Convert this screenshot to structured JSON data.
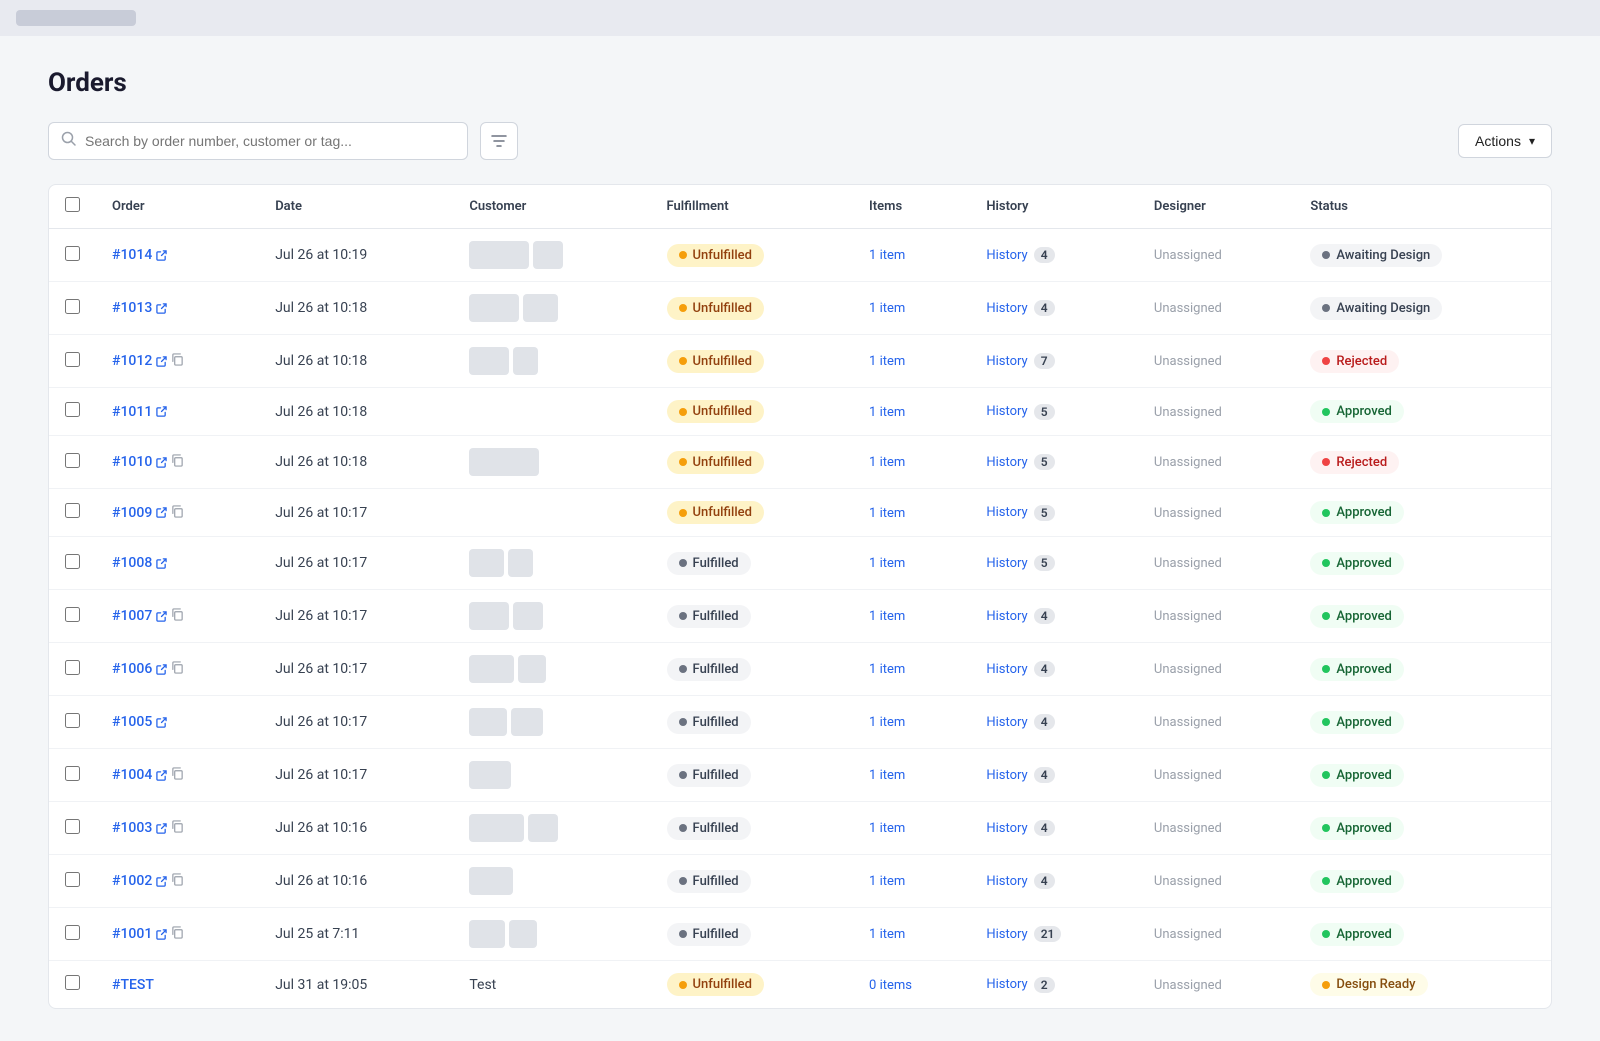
{
  "topbar": {
    "placeholder": "topbar-logo"
  },
  "page": {
    "title": "Orders"
  },
  "toolbar": {
    "search_placeholder": "Search by order number, customer or tag...",
    "actions_label": "Actions"
  },
  "table": {
    "columns": [
      "",
      "Order",
      "Date",
      "Customer",
      "Fulfillment",
      "Items",
      "History",
      "Designer",
      "Status"
    ],
    "rows": [
      {
        "id": "row-1014",
        "order": "#1014",
        "date": "Jul 26 at 10:19",
        "customer_blocks": [
          60,
          30
        ],
        "fulfillment": "Unfulfilled",
        "fulfillment_type": "unfulfilled",
        "items": "1 item",
        "history": "History",
        "history_count": "4",
        "designer": "Unassigned",
        "status": "Awaiting Design",
        "status_type": "awaiting",
        "has_external_icon": true,
        "has_copy_icon": false
      },
      {
        "id": "row-1013",
        "order": "#1013",
        "date": "Jul 26 at 10:18",
        "customer_blocks": [
          50,
          35
        ],
        "fulfillment": "Unfulfilled",
        "fulfillment_type": "unfulfilled",
        "items": "1 item",
        "history": "History",
        "history_count": "4",
        "designer": "Unassigned",
        "status": "Awaiting Design",
        "status_type": "awaiting",
        "has_external_icon": true,
        "has_copy_icon": false
      },
      {
        "id": "row-1012",
        "order": "#1012",
        "date": "Jul 26 at 10:18",
        "customer_blocks": [
          40,
          25
        ],
        "fulfillment": "Unfulfilled",
        "fulfillment_type": "unfulfilled",
        "items": "1 item",
        "history": "History",
        "history_count": "7",
        "designer": "Unassigned",
        "status": "Rejected",
        "status_type": "rejected",
        "has_external_icon": true,
        "has_copy_icon": true
      },
      {
        "id": "row-1011",
        "order": "#1011",
        "date": "Jul 26 at 10:18",
        "customer_blocks": [],
        "fulfillment": "Unfulfilled",
        "fulfillment_type": "unfulfilled",
        "items": "1 item",
        "history": "History",
        "history_count": "5",
        "designer": "Unassigned",
        "status": "Approved",
        "status_type": "approved",
        "has_external_icon": true,
        "has_copy_icon": false
      },
      {
        "id": "row-1010",
        "order": "#1010",
        "date": "Jul 26 at 10:18",
        "customer_blocks": [
          70
        ],
        "fulfillment": "Unfulfilled",
        "fulfillment_type": "unfulfilled",
        "items": "1 item",
        "history": "History",
        "history_count": "5",
        "designer": "Unassigned",
        "status": "Rejected",
        "status_type": "rejected",
        "has_external_icon": true,
        "has_copy_icon": true
      },
      {
        "id": "row-1009",
        "order": "#1009",
        "date": "Jul 26 at 10:17",
        "customer_blocks": [],
        "fulfillment": "Unfulfilled",
        "fulfillment_type": "unfulfilled",
        "items": "1 item",
        "history": "History",
        "history_count": "5",
        "designer": "Unassigned",
        "status": "Approved",
        "status_type": "approved",
        "has_external_icon": true,
        "has_copy_icon": true
      },
      {
        "id": "row-1008",
        "order": "#1008",
        "date": "Jul 26 at 10:17",
        "customer_blocks": [
          35,
          25
        ],
        "fulfillment": "Fulfilled",
        "fulfillment_type": "fulfilled",
        "items": "1 item",
        "history": "History",
        "history_count": "5",
        "designer": "Unassigned",
        "status": "Approved",
        "status_type": "approved",
        "has_external_icon": true,
        "has_copy_icon": false
      },
      {
        "id": "row-1007",
        "order": "#1007",
        "date": "Jul 26 at 10:17",
        "customer_blocks": [
          40,
          30
        ],
        "fulfillment": "Fulfilled",
        "fulfillment_type": "fulfilled",
        "items": "1 item",
        "history": "History",
        "history_count": "4",
        "designer": "Unassigned",
        "status": "Approved",
        "status_type": "approved",
        "has_external_icon": true,
        "has_copy_icon": true
      },
      {
        "id": "row-1006",
        "order": "#1006",
        "date": "Jul 26 at 10:17",
        "customer_blocks": [
          45,
          28
        ],
        "fulfillment": "Fulfilled",
        "fulfillment_type": "fulfilled",
        "items": "1 item",
        "history": "History",
        "history_count": "4",
        "designer": "Unassigned",
        "status": "Approved",
        "status_type": "approved",
        "has_external_icon": true,
        "has_copy_icon": true
      },
      {
        "id": "row-1005",
        "order": "#1005",
        "date": "Jul 26 at 10:17",
        "customer_blocks": [
          38,
          32
        ],
        "fulfillment": "Fulfilled",
        "fulfillment_type": "fulfilled",
        "items": "1 item",
        "history": "History",
        "history_count": "4",
        "designer": "Unassigned",
        "status": "Approved",
        "status_type": "approved",
        "has_external_icon": true,
        "has_copy_icon": false
      },
      {
        "id": "row-1004",
        "order": "#1004",
        "date": "Jul 26 at 10:17",
        "customer_blocks": [
          42
        ],
        "fulfillment": "Fulfilled",
        "fulfillment_type": "fulfilled",
        "items": "1 item",
        "history": "History",
        "history_count": "4",
        "designer": "Unassigned",
        "status": "Approved",
        "status_type": "approved",
        "has_external_icon": true,
        "has_copy_icon": true
      },
      {
        "id": "row-1003",
        "order": "#1003",
        "date": "Jul 26 at 10:16",
        "customer_blocks": [
          55,
          30
        ],
        "fulfillment": "Fulfilled",
        "fulfillment_type": "fulfilled",
        "items": "1 item",
        "history": "History",
        "history_count": "4",
        "designer": "Unassigned",
        "status": "Approved",
        "status_type": "approved",
        "has_external_icon": true,
        "has_copy_icon": true
      },
      {
        "id": "row-1002",
        "order": "#1002",
        "date": "Jul 26 at 10:16",
        "customer_blocks": [
          44
        ],
        "fulfillment": "Fulfilled",
        "fulfillment_type": "fulfilled",
        "items": "1 item",
        "history": "History",
        "history_count": "4",
        "designer": "Unassigned",
        "status": "Approved",
        "status_type": "approved",
        "has_external_icon": true,
        "has_copy_icon": true
      },
      {
        "id": "row-1001",
        "order": "#1001",
        "date": "Jul 25 at 7:11",
        "customer_blocks": [
          36,
          28
        ],
        "fulfillment": "Fulfilled",
        "fulfillment_type": "fulfilled",
        "items": "1 item",
        "history": "History",
        "history_count": "21",
        "designer": "Unassigned",
        "status": "Approved",
        "status_type": "approved",
        "has_external_icon": true,
        "has_copy_icon": true
      },
      {
        "id": "row-test",
        "order": "#TEST",
        "date": "Jul 31 at 19:05",
        "customer_blocks": [],
        "customer_text": "Test",
        "fulfillment": "Unfulfilled",
        "fulfillment_type": "unfulfilled",
        "items": "0 items",
        "history": "History",
        "history_count": "2",
        "designer": "Unassigned",
        "status": "Design Ready",
        "status_type": "design-ready",
        "has_external_icon": false,
        "has_copy_icon": false
      }
    ]
  }
}
